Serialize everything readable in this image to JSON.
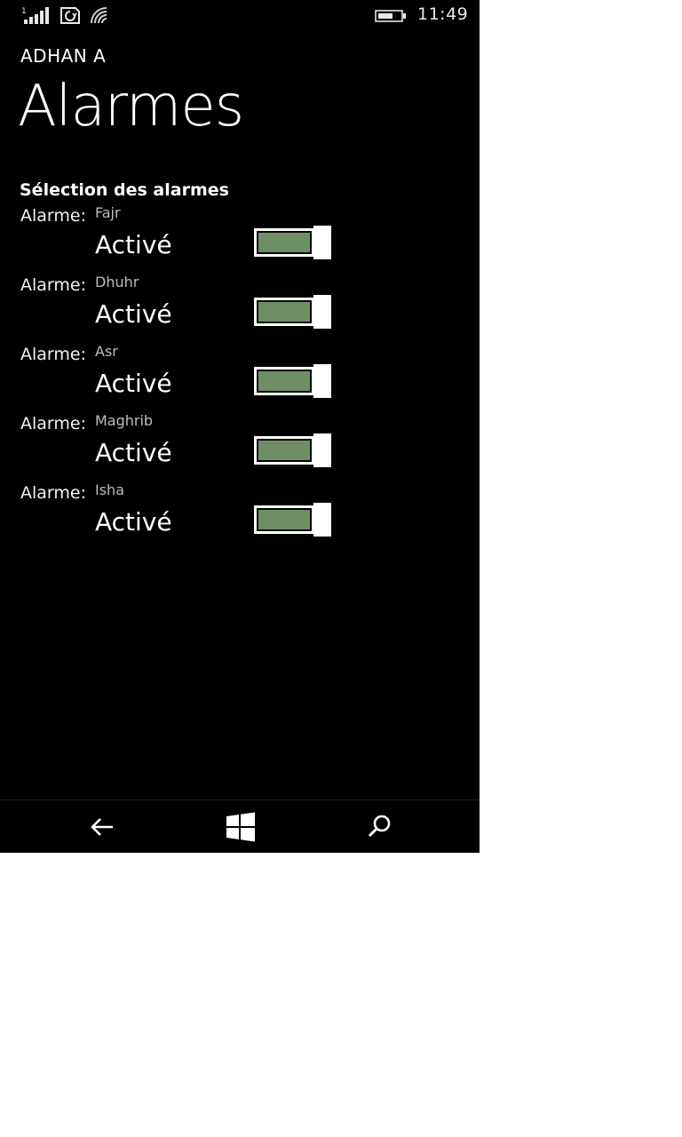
{
  "status_bar": {
    "time": "11:49",
    "signal_badge": "1",
    "icons": [
      "signal-icon",
      "sync-icon",
      "wifi-icon",
      "battery-icon"
    ]
  },
  "header": {
    "app_name": "ADHAN A",
    "page_title": "Alarmes"
  },
  "section": {
    "title": "Sélection des alarmes"
  },
  "alarms": [
    {
      "label": "Alarme:",
      "prayer": "Fajr",
      "state": "Activé",
      "enabled": true
    },
    {
      "label": "Alarme:",
      "prayer": "Dhuhr",
      "state": "Activé",
      "enabled": true
    },
    {
      "label": "Alarme:",
      "prayer": "Asr",
      "state": "Activé",
      "enabled": true
    },
    {
      "label": "Alarme:",
      "prayer": "Maghrib",
      "state": "Activé",
      "enabled": true
    },
    {
      "label": "Alarme:",
      "prayer": "Isha",
      "state": "Activé",
      "enabled": true
    }
  ],
  "nav_bar": {
    "icons": [
      "back-arrow-icon",
      "windows-logo-icon",
      "search-icon"
    ]
  },
  "colors": {
    "background": "#000000",
    "toggle_accent": "#6e8f66",
    "text": "#ffffff",
    "secondary_text": "#bdbdbd"
  }
}
